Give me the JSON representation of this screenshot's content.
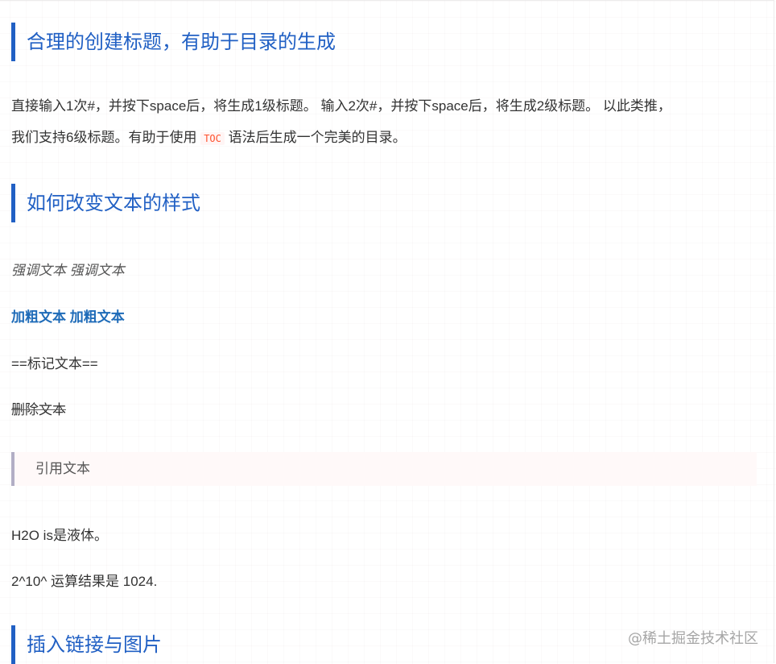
{
  "headings": {
    "h1": "合理的创建标题，有助于目录的生成",
    "h2": "如何改变文本的样式",
    "h3": "插入链接与图片"
  },
  "intro": {
    "line1": "直接输入1次#，并按下space后，将生成1级标题。 输入2次#，并按下space后，将生成2级标题。 以此类推，",
    "line2_before": "我们支持6级标题。有助于使用 ",
    "toc_code": "TOC",
    "line2_after": " 语法后生成一个完美的目录。"
  },
  "styles": {
    "emphasis": "强调文本 强调文本",
    "bold": "加粗文本 加粗文本",
    "mark": "==标记文本==",
    "strike": "删除文本",
    "quote": "引用文本",
    "subscript": "H2O is是液体。",
    "superscript": "2^10^ 运算结果是 1024."
  },
  "watermark": "@稀土掘金技术社区"
}
